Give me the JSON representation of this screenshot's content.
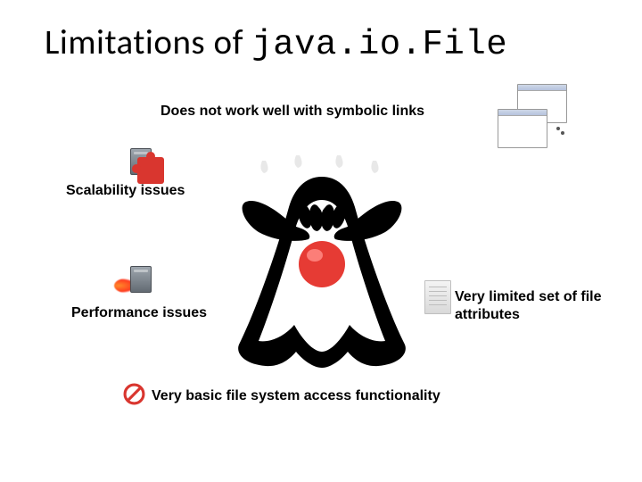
{
  "title": {
    "plain": "Limitations of ",
    "code": "java.io.File"
  },
  "points": {
    "symlinks": "Does not work well with symbolic links",
    "scalability": "Scalability issues",
    "performance": "Performance issues",
    "attributes": "Very limited set of file attributes",
    "basic": "Very basic file system access functionality"
  },
  "icons": {
    "windows": "linked-windows-icon",
    "puzzle": "server-puzzle-icon",
    "speed": "server-speed-icon",
    "doc": "document-icon",
    "forbid": "no-entry-icon",
    "mascot": "java-duke-mascot"
  }
}
